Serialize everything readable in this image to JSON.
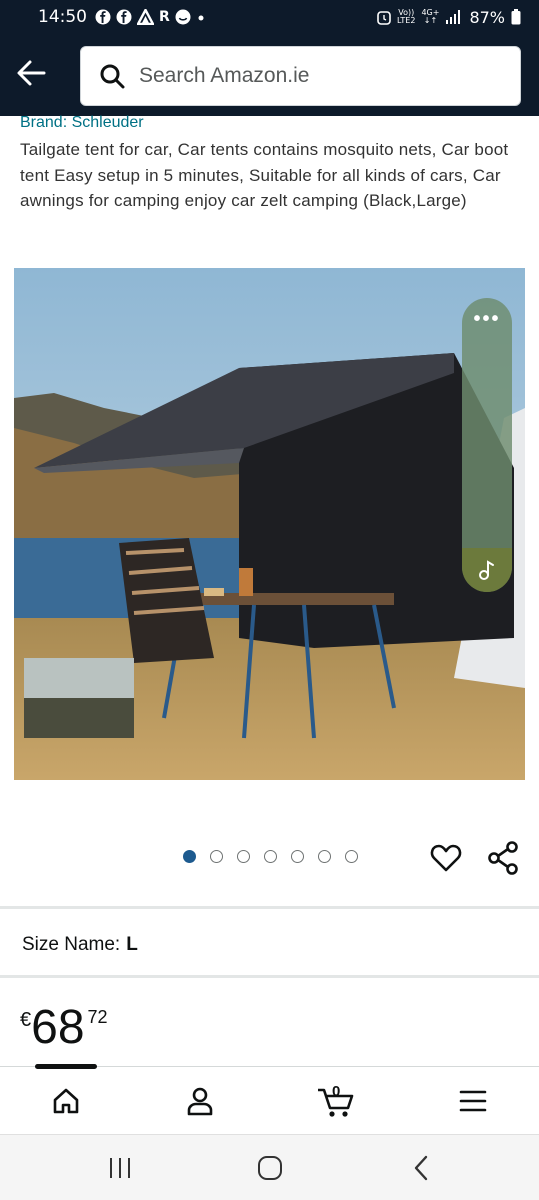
{
  "status_bar": {
    "time": "14:50",
    "app_icons": [
      "facebook-icon",
      "facebook-icon",
      "triangle-icon",
      "R",
      "smiley-icon",
      "dot"
    ],
    "r_letter": "R",
    "volte_top": "Vo))",
    "volte_bottom": "LTE2",
    "network": "4G+",
    "battery": "87%"
  },
  "header": {
    "search_placeholder": "Search Amazon.ie"
  },
  "product": {
    "brand": "Brand: Schleuder",
    "title": "Tailgate tent for car, Car tents contains mosquito nets, Car boot tent Easy setup in 5 minutes, Suitable for all kinds of cars, Car awnings for camping enjoy car zelt camping (Black,Large)",
    "image_count": 7,
    "active_image_index": 0,
    "size_label": "Size Name:",
    "size_value": "L",
    "price_currency": "€",
    "price_whole": "68",
    "price_fraction": "72"
  },
  "side_panel": {
    "menu_icon": "more-dots-icon",
    "music_icon": "music-note-icon"
  },
  "bottom_nav": {
    "items": [
      "home-icon",
      "account-icon",
      "cart-icon",
      "menu-icon"
    ],
    "cart_count": "0"
  },
  "system_nav": {
    "items": [
      "recents-icon",
      "home-icon",
      "back-icon"
    ]
  },
  "colors": {
    "header_bg": "#0d1a2a",
    "link": "#007185",
    "active_dot": "#1d5a8f"
  }
}
